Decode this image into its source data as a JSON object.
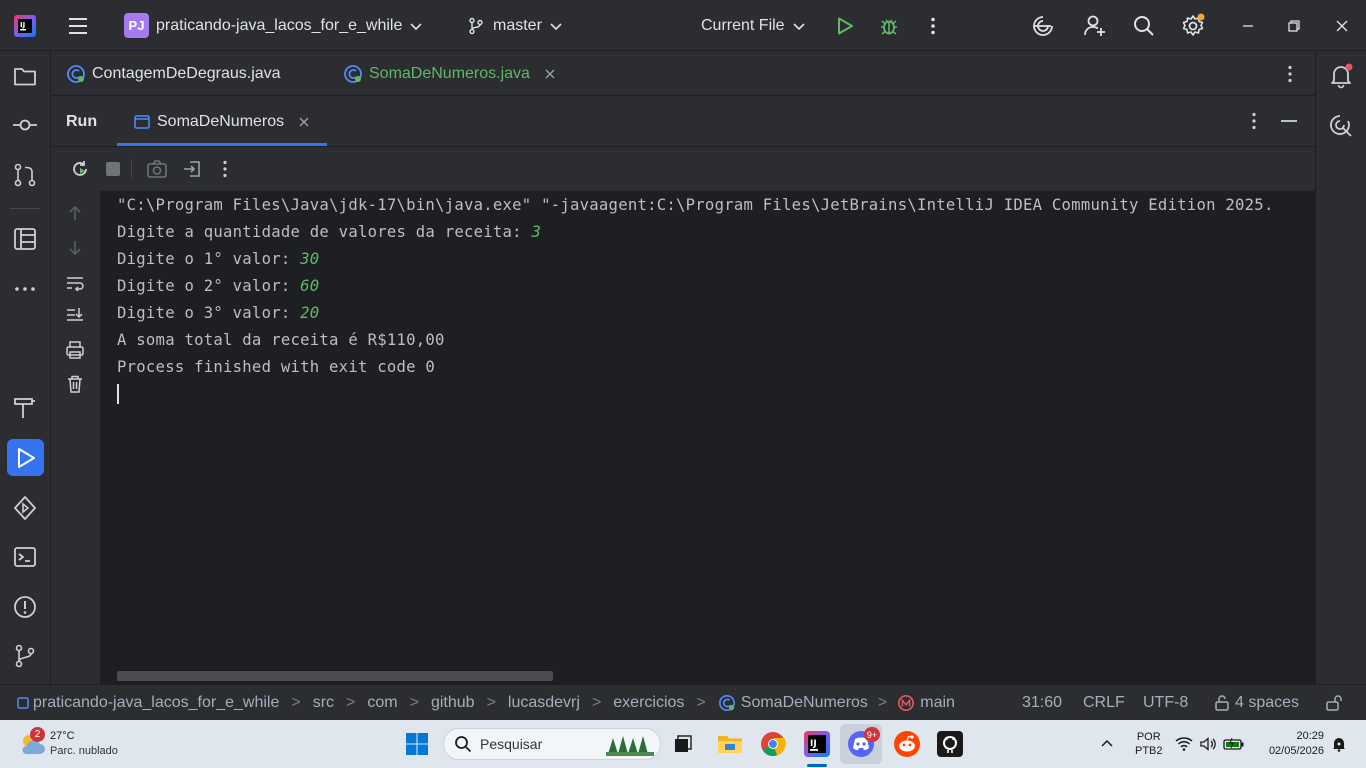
{
  "titlebar": {
    "app_logo": "intellij-logo",
    "project_badge": "PJ",
    "project_name": "praticando-java_lacos_for_e_while",
    "branch": "master",
    "run_config": "Current File"
  },
  "editor_tabs": [
    {
      "label": "ContagemDeDegraus.java",
      "active": false
    },
    {
      "label": "SomaDeNumeros.java",
      "active": true
    }
  ],
  "run_panel": {
    "title": "Run",
    "tab_label": "SomaDeNumeros"
  },
  "console": {
    "lines": [
      {
        "text": "\"C:\\Program Files\\Java\\jdk-17\\bin\\java.exe\" \"-javaagent:C:\\Program Files\\JetBrains\\IntelliJ IDEA Community Edition 2025.",
        "input": ""
      },
      {
        "text": "Digite a quantidade de valores da receita: ",
        "input": "3"
      },
      {
        "text": "Digite o 1° valor: ",
        "input": "30"
      },
      {
        "text": "Digite o 2° valor: ",
        "input": "60"
      },
      {
        "text": "Digite o 3° valor: ",
        "input": "20"
      },
      {
        "text": "A soma total da receita é R$110,00",
        "input": ""
      },
      {
        "text": "Process finished with exit code 0",
        "input": ""
      }
    ]
  },
  "statusbar": {
    "breadcrumb": [
      "praticando-java_lacos_for_e_while",
      "src",
      "com",
      "github",
      "lucasdevrj",
      "exercicios",
      "SomaDeNumeros",
      "main"
    ],
    "position": "31:60",
    "line_sep": "CRLF",
    "encoding": "UTF-8",
    "indent": "4 spaces"
  },
  "taskbar": {
    "weather_temp": "27°C",
    "weather_desc": "Parc. nublado",
    "weather_badge": "2",
    "search_placeholder": "Pesquisar",
    "discord_badge": "9+",
    "lang_top": "POR",
    "lang_bottom": "PTB2",
    "time": "20:29",
    "date": "02/05/2026"
  },
  "colors": {
    "accent": "#3574f0",
    "input_text": "#5fb865",
    "run_icon": "#5fb865",
    "debug_icon": "#5fb865"
  }
}
